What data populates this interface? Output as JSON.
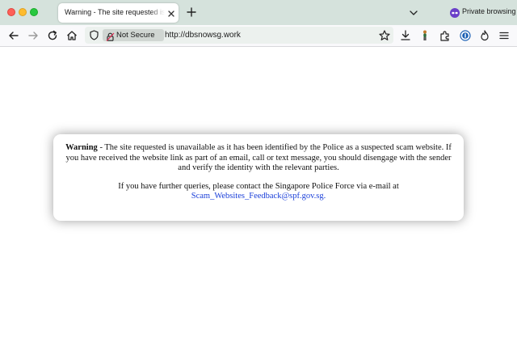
{
  "browser": {
    "tab": {
      "title": "Warning - The site requested is unavailable",
      "close_icon": "close-icon"
    },
    "new_tab_icon": "plus-icon",
    "tab_list_icon": "chevron-down-icon",
    "private_browsing": {
      "icon": "private-mask-icon",
      "label": "Private browsing"
    },
    "toolbar": {
      "buttons": [
        "back-icon",
        "forward-icon",
        "reload-icon",
        "home-icon"
      ],
      "right_buttons": [
        "bookmark-star-icon",
        "downloads-icon",
        "extension-figure-icon",
        "extensions-puzzle-icon",
        "password-manager-icon",
        "flame-icon",
        "menu-icon"
      ]
    },
    "urlbar": {
      "security_label": "Not Secure",
      "url": "http://dbsnowsg.work"
    }
  },
  "page": {
    "warning": {
      "lead": "Warning",
      "body": " - The site requested is unavailable as it has been identified by the Police as a suspected scam website. If you have received the website link as part of an email, call or text message, you should disengage with the sender and verify the identity with the relevant parties.",
      "contact_text": "If you have further queries, please contact the Singapore Police Force via e-mail at",
      "contact_email": "Scam_Websites_Feedback@spf.gov.sg."
    }
  },
  "colors": {
    "tabstrip": "#d5e2dc",
    "toolbar": "#f9f9fb",
    "link": "#1a3fd9",
    "private_accent": "#6a3fc8"
  }
}
